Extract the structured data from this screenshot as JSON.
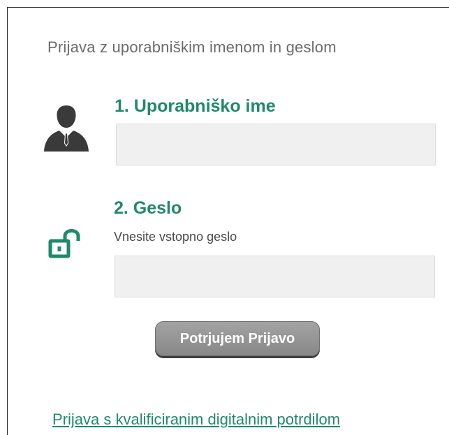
{
  "form": {
    "heading": "Prijava z uporabniškim imenom in geslom",
    "username": {
      "title": "1. Uporabniško ime",
      "icon": "user-icon",
      "value": "",
      "placeholder": ""
    },
    "password": {
      "title": "2. Geslo",
      "icon": "unlocked-padlock-icon",
      "hint": "Vnesite vstopno geslo",
      "value": "",
      "placeholder": ""
    },
    "submit_label": "Potrjujem Prijavo",
    "certificate_link": "Prijava s kvalificiranim digitalnim potrdilom"
  },
  "colors": {
    "accent": "#1f8a6a",
    "icon": "#3a3a3a",
    "button": "#999999",
    "input_bg": "#f0f0f0"
  }
}
